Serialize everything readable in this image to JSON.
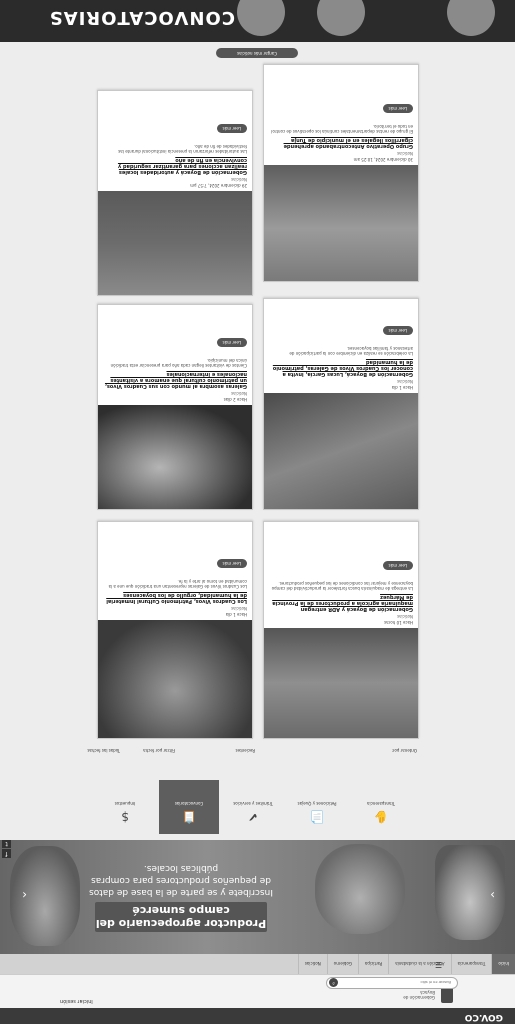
{
  "gov": {
    "logo": "GOV.CO"
  },
  "header": {
    "brand": "Gobernación de Boyacá",
    "login": "Iniciar sesión",
    "search_placeholder": "Buscar en el sitio"
  },
  "nav": {
    "items": [
      "Inicio",
      "Transparencia",
      "Atención a la ciudadanía",
      "Participa",
      "Gobierno",
      "Noticias"
    ]
  },
  "hero": {
    "title": "Productor agropecuario del campo sumercé",
    "subtitle": "Inscríbete y se parte de la base de datos de pequeños productores para compras públicas locales."
  },
  "icons": [
    {
      "label": "Transparencia",
      "glyph": "✋"
    },
    {
      "label": "Peticiones y Quejas",
      "glyph": "📄"
    },
    {
      "label": "Trámites y servicios",
      "glyph": "✔"
    },
    {
      "label": "Convocatorias",
      "glyph": "📋"
    },
    {
      "label": "Impuestos",
      "glyph": "$"
    }
  ],
  "filters": {
    "order": "Ordenar por:",
    "f1": "Recientes",
    "f2": "Filtrar por fecha",
    "f3": "Todas las fechas"
  },
  "cards": [
    {
      "date": "Hace 10 horas",
      "category": "Noticias",
      "title": "Gobernación de Boyacá y ADR entregan maquinaria agrícola a productores de la Provincia de Márquez",
      "excerpt": "La entrega de maquinaria busca fortalecer la productividad del campo boyacense y mejorar las condiciones de los pequeños productores.",
      "more": "Leer más"
    },
    {
      "date": "Hace 1 día",
      "category": "Noticias",
      "title": "Los Cuadros Vivos, Patrimonio Cultural Inmaterial de la humanidad, orgullo de los boyacenses",
      "excerpt": "Los Cuadros Vivos de Galeras representan una tradición que une a la comunidad en torno al arte y la fe.",
      "more": "Leer más"
    },
    {
      "date": "Hace 1 día",
      "category": "Noticias",
      "title": "Gobernación de Boyacá, Lucas García, invita a conocer los Cuadros Vivos de Galeras, patrimonio de la humanidad",
      "excerpt": "La celebración se realiza en diciembre con la participación de artesanos y familias boyacenses.",
      "more": "Leer más"
    },
    {
      "date": "Hace 2 días",
      "category": "Noticias",
      "title": "Galeras asombra al mundo con sus Cuadros Vivos, un patrimonio cultural que enamora a visitantes nacionales e internacionales",
      "excerpt": "Cientos de visitantes llegan cada año para presenciar esta tradición única del municipio.",
      "more": "Leer más"
    },
    {
      "date": "30 diciembre 2024, 10:25 am",
      "category": "Noticias",
      "title": "Grupo Operativo Antecontrabando aprehende cigarrillos ilegales en el municipio de Tunja",
      "excerpt": "El grupo de rentas departamentales continúa los operativos de control en todo el territorio.",
      "more": "Leer más"
    },
    {
      "date": "29 diciembre 2024, 7:57 pm",
      "category": "Noticias",
      "title": "Gobernación de Boyacá y autoridades locales realizan acciones para garantizar seguridad y convivencia en fin de año",
      "excerpt": "Las autoridades reforzaron la presencia institucional durante las festividades de fin de año.",
      "more": "Leer más"
    }
  ],
  "load_more": "Cargar más noticias",
  "promo": {
    "title": "CONVOCATORIAS"
  }
}
